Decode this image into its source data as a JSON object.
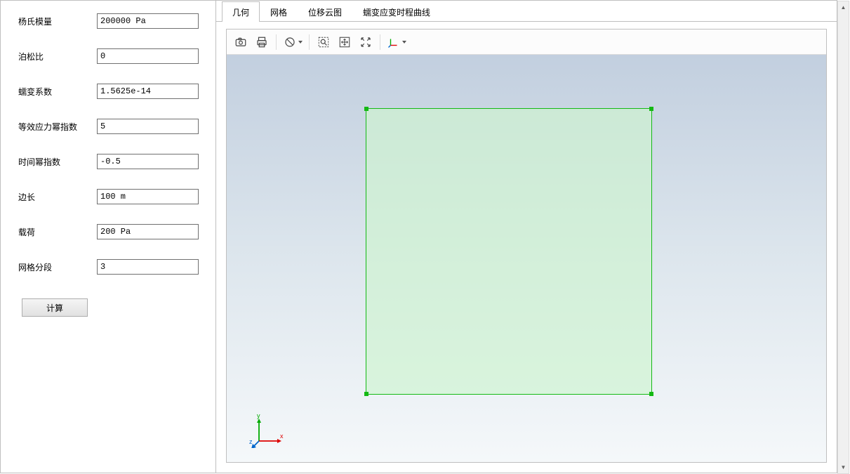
{
  "form": {
    "fields": [
      {
        "label": "杨氏模量",
        "value": "200000 Pa"
      },
      {
        "label": "泊松比",
        "value": "0"
      },
      {
        "label": "蠕变系数",
        "value": "1.5625e-14"
      },
      {
        "label": "等效应力幂指数",
        "value": "5"
      },
      {
        "label": "时间幂指数",
        "value": "-0.5"
      },
      {
        "label": "边长",
        "value": "100 m"
      },
      {
        "label": "载荷",
        "value": "200 Pa"
      },
      {
        "label": "网格分段",
        "value": "3"
      }
    ],
    "compute_label": "计算"
  },
  "tabs": {
    "items": [
      {
        "label": "几何",
        "active": true
      },
      {
        "label": "网格",
        "active": false
      },
      {
        "label": "位移云图",
        "active": false
      },
      {
        "label": "蠕变应变时程曲线",
        "active": false
      }
    ]
  },
  "toolbar": {
    "icons": [
      "camera-icon",
      "print-icon",
      "|",
      "no-entry-icon",
      "|",
      "zoom-box-icon",
      "pan-icon",
      "zoom-extents-icon",
      "|",
      "axis-triad-icon"
    ]
  },
  "triad": {
    "y_label": "y",
    "x_label": "x",
    "z_label": "z"
  }
}
